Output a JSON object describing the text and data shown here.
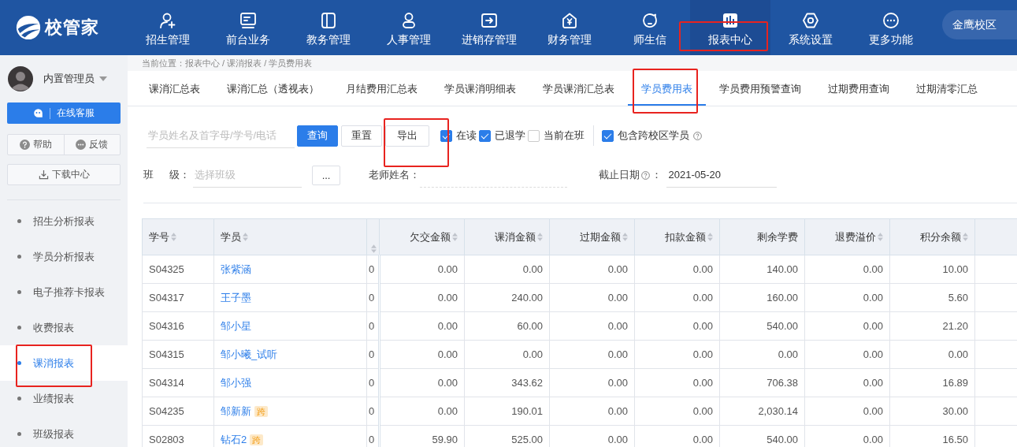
{
  "brand": {
    "name": "校管家"
  },
  "nav": [
    {
      "label": "招生管理",
      "selected": false,
      "highlighted": false
    },
    {
      "label": "前台业务",
      "selected": false,
      "highlighted": false
    },
    {
      "label": "教务管理",
      "selected": false,
      "highlighted": false
    },
    {
      "label": "人事管理",
      "selected": false,
      "highlighted": false
    },
    {
      "label": "进销存管理",
      "selected": false,
      "highlighted": false
    },
    {
      "label": "财务管理",
      "selected": false,
      "highlighted": false
    },
    {
      "label": "师生信",
      "selected": false,
      "highlighted": false
    },
    {
      "label": "报表中心",
      "selected": true,
      "highlighted": true
    },
    {
      "label": "系统设置",
      "selected": false,
      "highlighted": false
    },
    {
      "label": "更多功能",
      "selected": false,
      "highlighted": false
    }
  ],
  "campus": {
    "label": "金鹰校区"
  },
  "user": {
    "name": "内置管理员"
  },
  "sidebar": {
    "service_button": "在线客服",
    "help_button": "帮助",
    "feedback_button": "反馈",
    "download_button": "下载中心",
    "items": [
      {
        "label": "招生分析报表",
        "selected": false,
        "highlighted": false
      },
      {
        "label": "学员分析报表",
        "selected": false,
        "highlighted": false
      },
      {
        "label": "电子推荐卡报表",
        "selected": false,
        "highlighted": false
      },
      {
        "label": "收费报表",
        "selected": false,
        "highlighted": false
      },
      {
        "label": "课消报表",
        "selected": true,
        "highlighted": true
      },
      {
        "label": "业绩报表",
        "selected": false,
        "highlighted": false
      },
      {
        "label": "班级报表",
        "selected": false,
        "highlighted": false
      }
    ]
  },
  "breadcrumb": "当前位置：报表中心 / 课消报表 / 学员费用表",
  "tabs": [
    {
      "label": "课消汇总表",
      "selected": false,
      "highlighted": false
    },
    {
      "label": "课消汇总（透视表）",
      "selected": false,
      "highlighted": false
    },
    {
      "label": "月结费用汇总表",
      "selected": false,
      "highlighted": false
    },
    {
      "label": "学员课消明细表",
      "selected": false,
      "highlighted": false
    },
    {
      "label": "学员课消汇总表",
      "selected": false,
      "highlighted": false
    },
    {
      "label": "学员费用表",
      "selected": true,
      "highlighted": true
    },
    {
      "label": "学员费用预警查询",
      "selected": false,
      "highlighted": false
    },
    {
      "label": "过期费用查询",
      "selected": false,
      "highlighted": false
    },
    {
      "label": "过期清零汇总",
      "selected": false,
      "highlighted": false
    }
  ],
  "filters": {
    "search": {
      "placeholder": "学员姓名及首字母/学号/电话"
    },
    "query_button": "查询",
    "reset_button": "重置",
    "export_button": {
      "label": "导出",
      "highlighted": true
    },
    "checkboxes": [
      {
        "label": "在读",
        "checked": true,
        "help": false,
        "separated": false
      },
      {
        "label": "已退学",
        "checked": true,
        "help": false,
        "separated": false
      },
      {
        "label": "当前在班",
        "checked": false,
        "help": false,
        "separated": false
      },
      {
        "label": "包含跨校区学员",
        "checked": true,
        "help": true,
        "separated": true
      }
    ],
    "class_label": "班 级：",
    "class": {
      "placeholder": "选择班级"
    },
    "class_picker_button": "...",
    "teacher_label": "老师姓名：",
    "date_label": "截止日期",
    "date_label_suffix": "：",
    "date": {
      "value": "2021-05-20"
    }
  },
  "table": {
    "columns": [
      {
        "label": "学号",
        "kind": "text",
        "sortable": true
      },
      {
        "label": "学员",
        "kind": "text",
        "sortable": true
      },
      {
        "kind": "narrow",
        "sortable": true
      },
      {
        "label": "欠交金额",
        "kind": "number",
        "sortable": true
      },
      {
        "label": "课消金额",
        "kind": "number",
        "sortable": true
      },
      {
        "label": "过期金额",
        "kind": "number",
        "sortable": true
      },
      {
        "label": "扣款金额",
        "kind": "number",
        "sortable": true
      },
      {
        "label": "剩余学费",
        "kind": "number",
        "sortable": false
      },
      {
        "label": "退费溢价",
        "kind": "number",
        "sortable": true
      },
      {
        "label": "积分余额",
        "kind": "number",
        "sortable": true
      }
    ],
    "rows": [
      {
        "cells": [
          "S04325",
          {
            "name": "张紫涵"
          },
          "0",
          "0.00",
          "0.00",
          "0.00",
          "0.00",
          "140.00",
          "0.00",
          "10.00"
        ]
      },
      {
        "cells": [
          "S04317",
          {
            "name": "王子墨"
          },
          "0",
          "0.00",
          "240.00",
          "0.00",
          "0.00",
          "160.00",
          "0.00",
          "5.60"
        ]
      },
      {
        "cells": [
          "S04316",
          {
            "name": "邹小星"
          },
          "0",
          "0.00",
          "60.00",
          "0.00",
          "0.00",
          "540.00",
          "0.00",
          "21.20"
        ]
      },
      {
        "cells": [
          "S04315",
          {
            "name": "邹小曦_试听"
          },
          "0",
          "0.00",
          "0.00",
          "0.00",
          "0.00",
          "0.00",
          "0.00",
          "0.00"
        ]
      },
      {
        "cells": [
          "S04314",
          {
            "name": "邹小强"
          },
          "0",
          "0.00",
          "343.62",
          "0.00",
          "0.00",
          "706.38",
          "0.00",
          "16.89"
        ]
      },
      {
        "cells": [
          "S04235",
          {
            "name": "邹新新",
            "badge": "跨"
          },
          "0",
          "0.00",
          "190.01",
          "0.00",
          "0.00",
          "2,030.14",
          "0.00",
          "30.00"
        ]
      },
      {
        "cells": [
          "S02803",
          {
            "name": "钻石2",
            "badge": "跨"
          },
          "0",
          "59.90",
          "525.00",
          "0.00",
          "0.00",
          "540.00",
          "0.00",
          "16.50"
        ]
      }
    ]
  }
}
